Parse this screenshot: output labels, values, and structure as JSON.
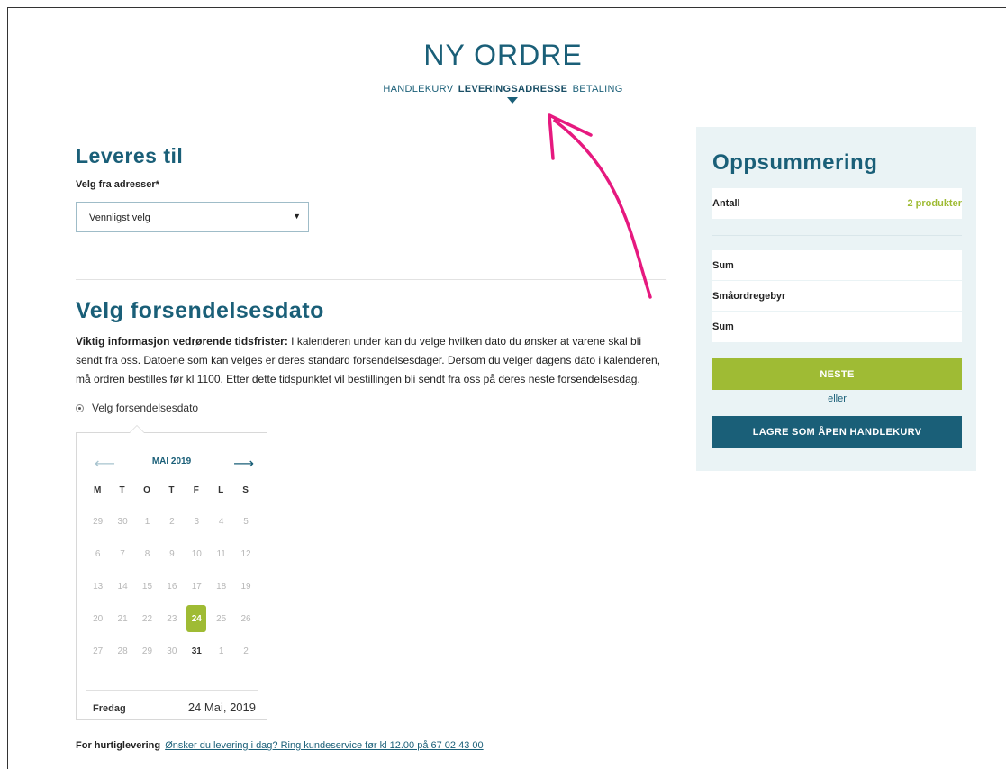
{
  "page": {
    "title": "NY ORDRE",
    "steps": [
      "HANDLEKURV",
      "LEVERINGSADRESSE",
      "BETALING"
    ],
    "active_step": "LEVERINGSADRESSE"
  },
  "delivery": {
    "heading": "Leveres til",
    "select_label": "Velg fra adresser*",
    "select_value": "Vennligst velg"
  },
  "shipping_date": {
    "heading": "Velg forsendelsesdato",
    "info_bold": "Viktig informasjon vedrørende tidsfrister:",
    "info_text": " I kalenderen under kan du velge hvilken dato du ønsker at varene skal bli sendt fra oss. Datoene som kan velges er deres standard forsendelsesdager. Dersom du velger dagens dato i kalenderen, må ordren bestilles før kl 1100. Etter dette tidspunktet vil bestillingen bli sendt fra oss på deres neste forsendelsesdag.",
    "radio_label": "Velg forsendelsesdato"
  },
  "calendar": {
    "month": "MAI 2019",
    "prev_icon": "arrow-left-icon",
    "next_icon": "arrow-right-icon",
    "weekdays": [
      "M",
      "T",
      "O",
      "T",
      "F",
      "L",
      "S"
    ],
    "weeks": [
      [
        "29",
        "30",
        "1",
        "2",
        "3",
        "4",
        "5"
      ],
      [
        "6",
        "7",
        "8",
        "9",
        "10",
        "11",
        "12"
      ],
      [
        "13",
        "14",
        "15",
        "16",
        "17",
        "18",
        "19"
      ],
      [
        "20",
        "21",
        "22",
        "23",
        "24",
        "25",
        "26"
      ],
      [
        "27",
        "28",
        "29",
        "30",
        "31",
        "1",
        "2"
      ]
    ],
    "selected": "24",
    "emphasized": "31",
    "footer_day": "Fredag",
    "footer_date": "24 Mai, 2019"
  },
  "express": {
    "label": "For hurtiglevering",
    "link": "Ønsker du levering i dag? Ring kundeservice før kl 12.00 på 67 02 43 00"
  },
  "summary": {
    "heading": "Oppsummering",
    "count_label": "Antall",
    "count_value": "2 produkter",
    "rows": [
      {
        "label": "Sum",
        "value": ""
      },
      {
        "label": "Småordregebyr",
        "value": ""
      },
      {
        "label": "Sum",
        "value": ""
      }
    ],
    "next_button": "NESTE",
    "or_text": "eller",
    "save_button": "LAGRE SOM ÅPEN HANDLEKURV"
  },
  "colors": {
    "brand": "#1a5f78",
    "accent": "#9fbb34",
    "summary_bg": "#eaf3f5",
    "annotation": "#e6197f"
  }
}
